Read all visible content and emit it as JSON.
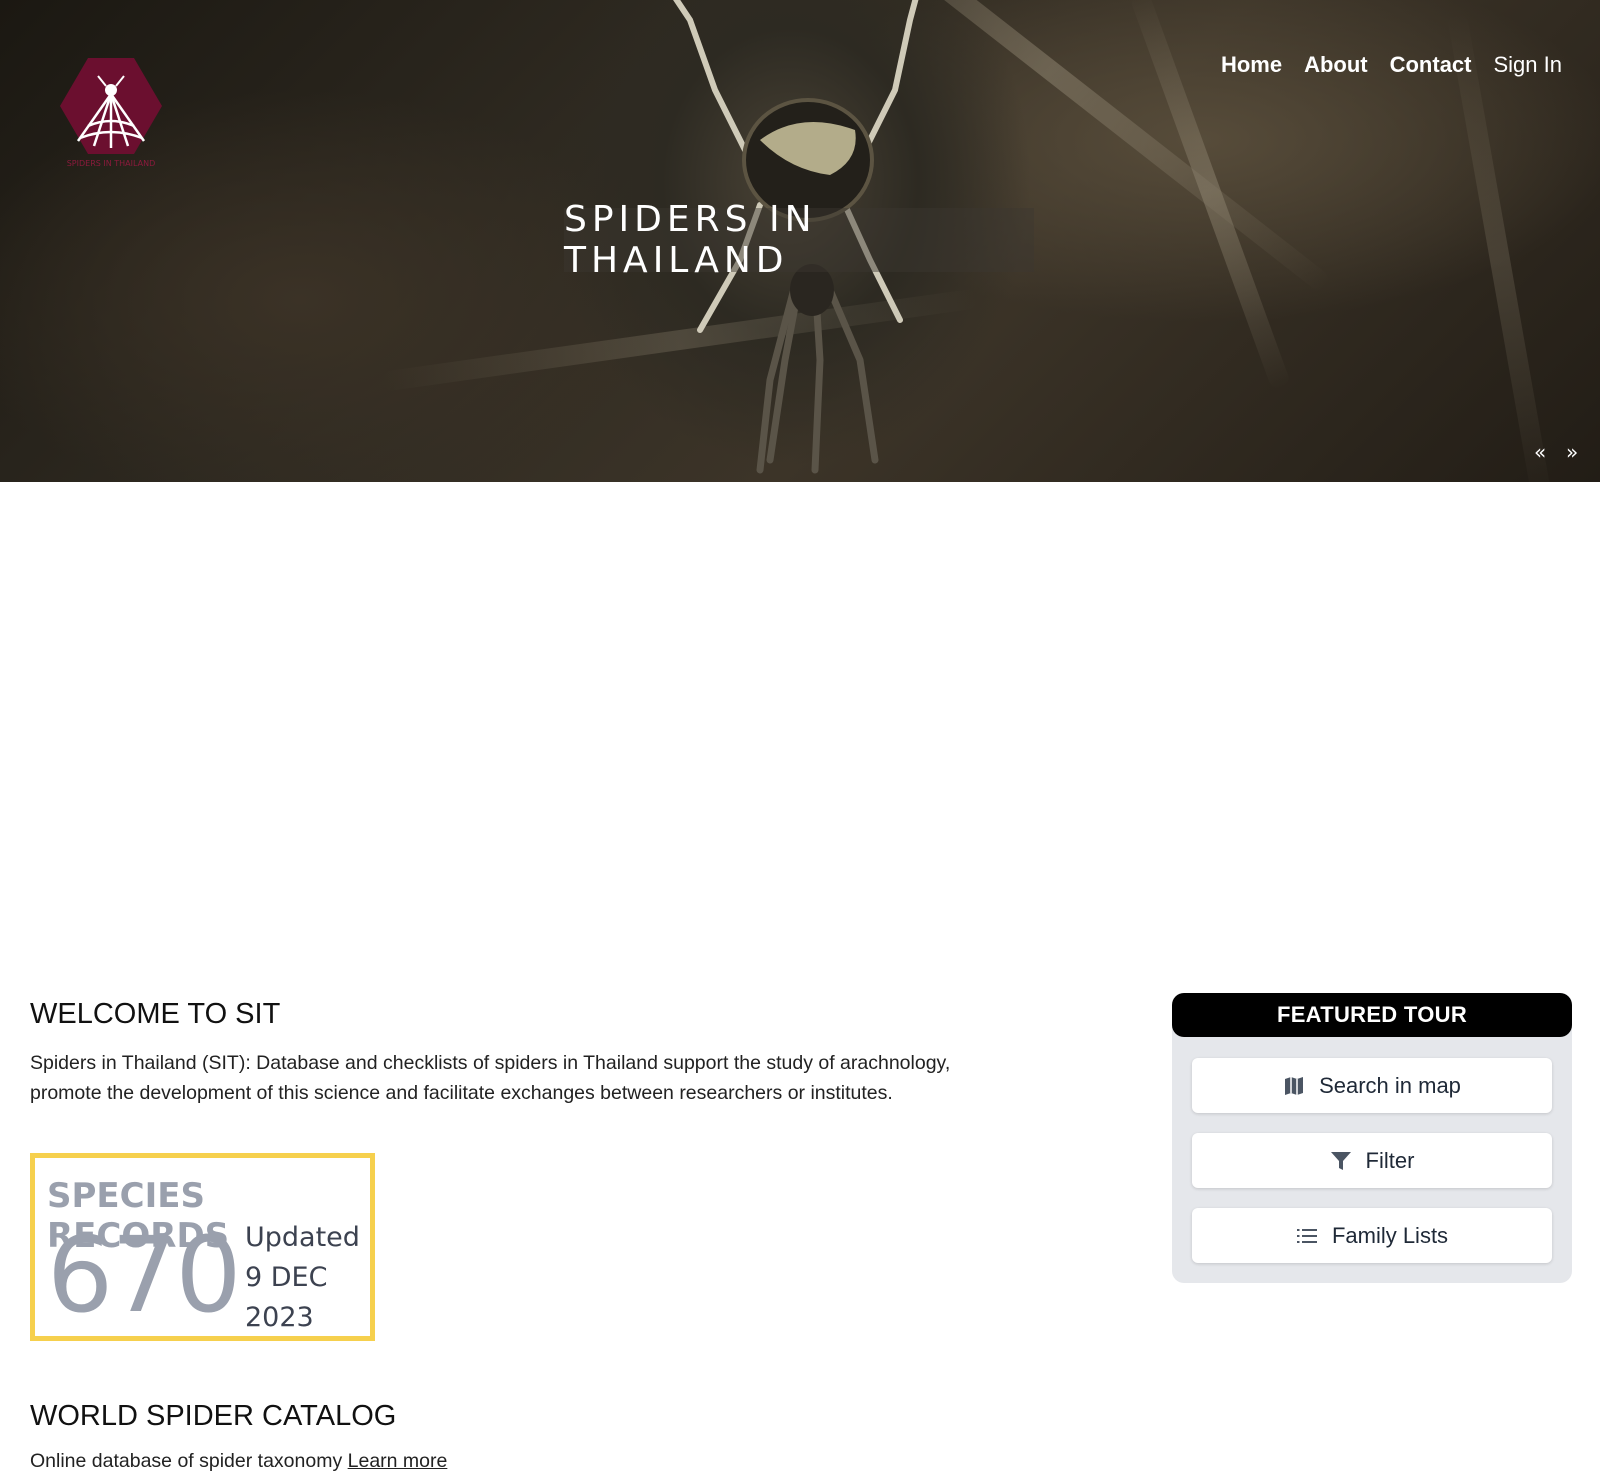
{
  "nav": {
    "home": "Home",
    "about": "About",
    "contact": "Contact",
    "sign_in": "Sign In"
  },
  "logo": {
    "text": "SPIDERS IN THAILAND",
    "color": "#6b0f2f"
  },
  "hero": {
    "title": "SPIDERS IN THAILAND",
    "prev": "«",
    "next": "»"
  },
  "welcome": {
    "title": "WELCOME TO SIT",
    "text": "Spiders in Thailand (SIT): Database and checklists of spiders in Thailand support the study of arachnology, promote the development of this science and facilitate exchanges between researchers or institutes."
  },
  "records": {
    "title": "SPECIES RECORDS",
    "count": "670",
    "updated_label": "Updated",
    "updated_date": "9 DEC",
    "updated_year": "2023",
    "border_color": "#f6d04d"
  },
  "catalog": {
    "title": "WORLD SPIDER CATALOG",
    "text": "Online database of spider taxonomy",
    "link": "Learn more"
  },
  "tour": {
    "header": "FEATURED TOUR",
    "buttons": [
      {
        "label": "Search in map",
        "icon": "map-icon"
      },
      {
        "label": "Filter",
        "icon": "filter-icon"
      },
      {
        "label": "Family Lists",
        "icon": "list-icon"
      }
    ]
  }
}
